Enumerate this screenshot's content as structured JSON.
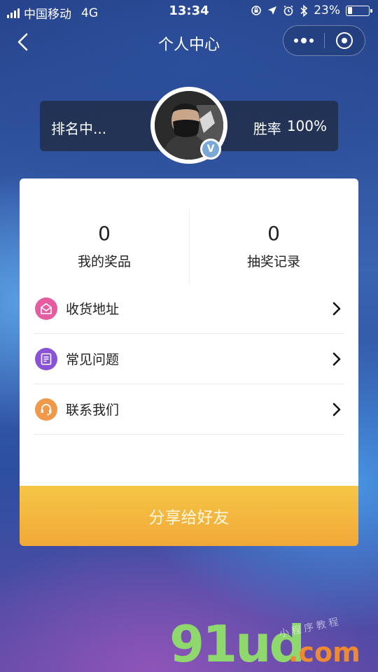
{
  "status_bar": {
    "carrier": "中国移动",
    "network": "4G",
    "time": "13:34",
    "battery": "23%",
    "battery_level": 0.23
  },
  "nav": {
    "title": "个人中心"
  },
  "profile": {
    "rank_label": "排名中...",
    "win_rate_label": "胜率",
    "win_rate_value": "100%",
    "badge": "V"
  },
  "stats": [
    {
      "value": "0",
      "label": "我的奖品"
    },
    {
      "value": "0",
      "label": "抽奖记录"
    }
  ],
  "menu": [
    {
      "label": "收货地址",
      "icon": "address-icon",
      "color": "#e65ca0"
    },
    {
      "label": "常见问题",
      "icon": "faq-icon",
      "color": "#8a52d6"
    },
    {
      "label": "联系我们",
      "icon": "headset-icon",
      "color": "#f0994a"
    }
  ],
  "share_button": "分享给好友",
  "watermark": {
    "main": "91ud",
    "suffix": ".com",
    "small": "小程序教程"
  },
  "colors": {
    "share_top": "#f6c646",
    "share_bottom": "#f1a838"
  }
}
